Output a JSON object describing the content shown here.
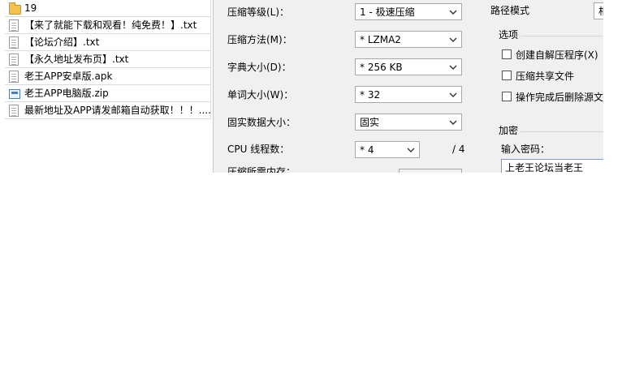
{
  "files": [
    {
      "name": "19",
      "icon": "folder-icon"
    },
    {
      "name": "【来了就能下载和观看！纯免费！】.txt",
      "icon": "text-file-icon"
    },
    {
      "name": "【论坛介绍】.txt",
      "icon": "text-file-icon"
    },
    {
      "name": "【永久地址发布页】.txt",
      "icon": "text-file-icon"
    },
    {
      "name": "老王APP安卓版.apk",
      "icon": "file-icon"
    },
    {
      "name": "老王APP电脑版.zip",
      "icon": "zip-file-icon"
    },
    {
      "name": "最新地址及APP请发邮箱自动获取！！！....",
      "icon": "text-file-icon"
    }
  ],
  "compression": {
    "level_label": "压缩等级(L)：",
    "level_value": "1 - 极速压缩",
    "method_label": "压缩方法(M)：",
    "method_value": "* LZMA2",
    "dict_label": "字典大小(D)：",
    "dict_value": "* 256 KB",
    "word_label": "单词大小(W)：",
    "word_value": "* 32",
    "solid_label": "固实数据大小：",
    "solid_value": "固实",
    "cpu_label": "CPU 线程数：",
    "cpu_value": "* 4",
    "cpu_total": "/ 4",
    "memory_label": "压缩所需内存："
  },
  "right_panel": {
    "path_mode_label": "路径模式",
    "path_mode_value": "相",
    "options_title": "选项",
    "options": [
      {
        "label": "创建自解压程序(X)",
        "checked": false
      },
      {
        "label": "压缩共享文件",
        "checked": false
      },
      {
        "label": "操作完成后删除源文件",
        "checked": false
      }
    ],
    "encrypt_title": "加密",
    "password_label": "输入密码：",
    "password_value": "上老王论坛当老王"
  },
  "colors": {
    "dialog_bg": "#f0f0f0",
    "input_border": "#a8a8a8",
    "focus_border": "#7a9cc6"
  }
}
